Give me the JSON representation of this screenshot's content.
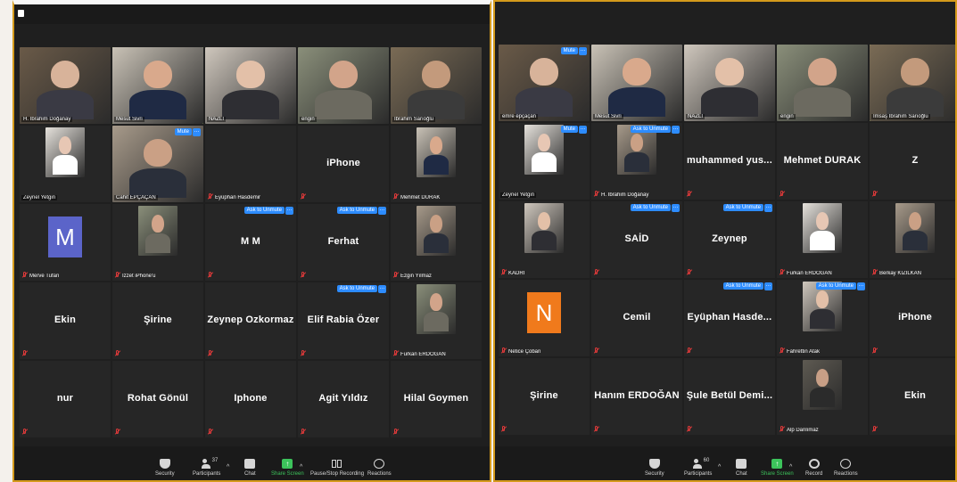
{
  "left": {
    "tiles": [
      {
        "name": "H. İbrahim Doğanay",
        "kind": "photo"
      },
      {
        "name": "Mesut Sivri",
        "kind": "photo",
        "active": true
      },
      {
        "name": "NAZLI",
        "kind": "photo"
      },
      {
        "name": "engin",
        "kind": "photo"
      },
      {
        "name": "İbrahim Sarıoğlu",
        "kind": "photo"
      },
      {
        "name": "Zeynel Yetgin",
        "kind": "photo"
      },
      {
        "name": "Cahit EPÇAÇAN",
        "kind": "photo",
        "mute": "Mute"
      },
      {
        "name": "Eyüphan Hasdemir",
        "kind": "blank",
        "muted": true
      },
      {
        "name": "iPhone",
        "kind": "text",
        "muted": true
      },
      {
        "name": "Mehmet DURAK",
        "kind": "photo",
        "muted": true
      },
      {
        "name": "Merve Tufan",
        "kind": "letter",
        "letter": "M",
        "muted": true
      },
      {
        "name": "İzzet iPhone'u",
        "kind": "photo",
        "muted": true
      },
      {
        "name": "M M",
        "kind": "text",
        "muted": true,
        "unmute": "Ask to Unmute"
      },
      {
        "name": "Ferhat",
        "kind": "text",
        "muted": true,
        "unmute": "Ask to Unmute"
      },
      {
        "name": "Ezgin Yılmaz",
        "kind": "photo",
        "muted": true
      },
      {
        "name": "Ekin",
        "kind": "text",
        "muted": true
      },
      {
        "name": "Şirine",
        "kind": "text",
        "muted": true
      },
      {
        "name": "Zeynep Ozkormaz",
        "kind": "text",
        "muted": true
      },
      {
        "name": "Elif Rabia Özer",
        "kind": "text",
        "muted": true,
        "unmute": "Ask to Unmute"
      },
      {
        "name": "Furkan ERDOĞAN",
        "kind": "photo",
        "muted": true
      },
      {
        "name": "nur",
        "kind": "text",
        "muted": true
      },
      {
        "name": "Rohat Gönül",
        "kind": "text",
        "muted": true
      },
      {
        "name": "Iphone",
        "kind": "text",
        "muted": true
      },
      {
        "name": "Agit Yıldız",
        "kind": "text",
        "muted": true
      },
      {
        "name": "Hilal Goymen",
        "kind": "text",
        "muted": true
      }
    ],
    "toolbar": {
      "security": "Security",
      "participants": "Participants",
      "participants_count": "37",
      "chat": "Chat",
      "share": "Share Screen",
      "recording": "Pause/Stop Recording",
      "reactions": "Reactions"
    }
  },
  "right": {
    "tiles": [
      {
        "name": "emre epçaçan",
        "kind": "photo",
        "mute": "Mute"
      },
      {
        "name": "Mesut Sivri",
        "kind": "photo"
      },
      {
        "name": "NAZLI",
        "kind": "photo"
      },
      {
        "name": "engin",
        "kind": "photo"
      },
      {
        "name": "İmsaş İbrahim Sarıoğlu",
        "kind": "photo",
        "active": true
      },
      {
        "name": "Zeynel Yetgin",
        "kind": "photo",
        "mute": "Mute"
      },
      {
        "name": "H. İbrahim Doğanay",
        "kind": "photo",
        "muted": true,
        "unmute": "Ask to Unmute"
      },
      {
        "name": "muhammed  yus...",
        "kind": "text",
        "muted": true
      },
      {
        "name": "Mehmet DURAK",
        "kind": "text",
        "muted": true
      },
      {
        "name": "Z",
        "kind": "text",
        "muted": true
      },
      {
        "name": "KADRİ",
        "kind": "photo",
        "muted": true
      },
      {
        "name": "SAİD",
        "kind": "text",
        "muted": true,
        "unmute": "Ask to Unmute"
      },
      {
        "name": "Zeynep",
        "kind": "text",
        "muted": true,
        "unmute": "Ask to Unmute"
      },
      {
        "name": "Furkan ERDOĞAN",
        "kind": "photo",
        "muted": true
      },
      {
        "name": "Berkay KIZILKAN",
        "kind": "photo",
        "muted": true
      },
      {
        "name": "Netice Çoban",
        "kind": "letter",
        "letter": "N",
        "muted": true
      },
      {
        "name": "Cemil",
        "kind": "text",
        "muted": true
      },
      {
        "name": "Eyüphan  Hasde...",
        "kind": "text",
        "muted": true,
        "unmute": "Ask to Unmute"
      },
      {
        "name": "Fahrettin Atak",
        "kind": "photo",
        "muted": true,
        "unmute": "Ask to Unmute"
      },
      {
        "name": "iPhone",
        "kind": "text",
        "muted": true
      },
      {
        "name": "Şirine",
        "kind": "text",
        "muted": true
      },
      {
        "name": "Hanım ERDOĞAN",
        "kind": "text",
        "muted": true
      },
      {
        "name": "Şule  Betül  Demi...",
        "kind": "text",
        "muted": true
      },
      {
        "name": "Alp Danlımaz",
        "kind": "photo",
        "muted": true
      },
      {
        "name": "Ekin",
        "kind": "text",
        "muted": true
      }
    ],
    "toolbar": {
      "security": "Security",
      "participants": "Participants",
      "participants_count": "60",
      "chat": "Chat",
      "share": "Share Screen",
      "record": "Record",
      "reactions": "Reactions"
    }
  },
  "colors": {
    "border_gold": "#d49a1b",
    "active_outline": "#b6d66b",
    "unmute_blue": "#2d8cff",
    "share_green": "#3cc35b",
    "letter_m_bg": "#5b64c9",
    "letter_n_bg": "#f07a1c"
  }
}
